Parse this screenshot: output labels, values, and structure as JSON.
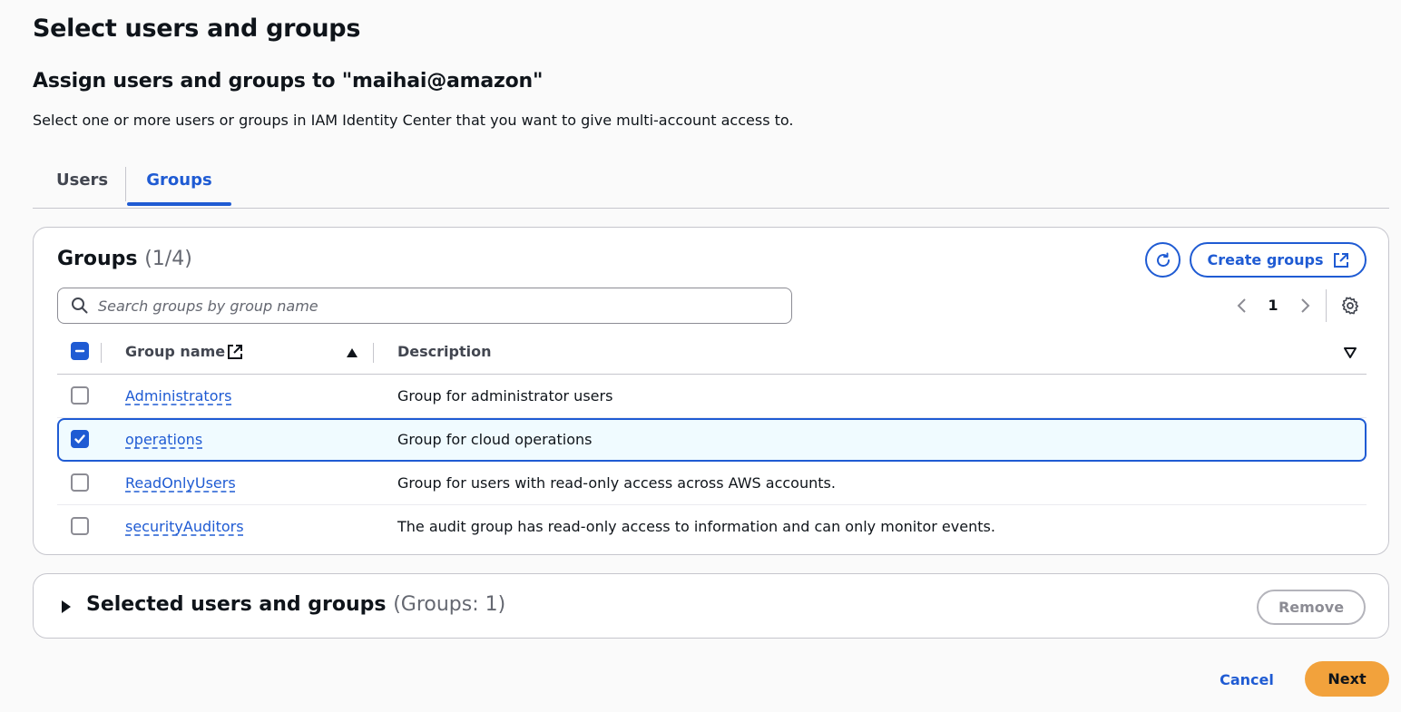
{
  "page": {
    "title": "Select users and groups",
    "subtitle": "Assign users and groups to \"maihai@amazon\"",
    "description": "Select one or more users or groups in IAM Identity Center that you want to give multi-account access to."
  },
  "tabs": [
    {
      "label": "Users",
      "active": false
    },
    {
      "label": "Groups",
      "active": true
    }
  ],
  "groups_panel": {
    "heading": "Groups",
    "count": "(1/4)",
    "create_label": "Create groups",
    "search": {
      "placeholder": "Search groups by group name",
      "value": ""
    },
    "page": "1",
    "columns": {
      "name": "Group name",
      "description": "Description"
    },
    "rows": [
      {
        "name": "Administrators",
        "description": "Group for administrator users",
        "checked": false
      },
      {
        "name": "operations",
        "description": "Group for cloud operations",
        "checked": true
      },
      {
        "name": "ReadOnlyUsers",
        "description": "Group for users with read-only access across AWS accounts.",
        "checked": false
      },
      {
        "name": "securityAuditors",
        "description": "The audit group has read-only access to information and can only monitor events.",
        "checked": false
      }
    ]
  },
  "selected_panel": {
    "title": "Selected users and groups",
    "count": "(Groups: 1)",
    "remove_label": "Remove"
  },
  "footer": {
    "cancel_label": "Cancel",
    "next_label": "Next"
  },
  "colors": {
    "accent": "#1f5bd3",
    "primary_button": "#f2a23c",
    "selected_row_bg": "#f0fbff"
  }
}
